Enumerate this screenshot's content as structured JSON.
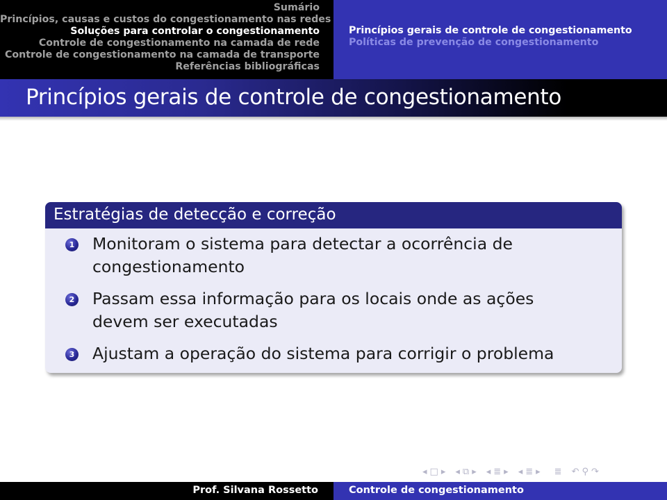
{
  "header": {
    "sections": [
      {
        "label": "Sumário",
        "current": false
      },
      {
        "label": "Princípios, causas e custos do congestionamento nas redes",
        "current": false
      },
      {
        "label": "Soluções para controlar o congestionamento",
        "current": true
      },
      {
        "label": "Controle de congestionamento na camada de rede",
        "current": false
      },
      {
        "label": "Controle de congestionamento na camada de transporte",
        "current": false
      },
      {
        "label": "Referências bibliográficas",
        "current": false
      }
    ],
    "subsections": [
      {
        "label": "Princípios gerais de controle de congestionamento",
        "current": true
      },
      {
        "label": "Políticas de prevenção de congestionamento",
        "current": false
      }
    ]
  },
  "frame": {
    "title": "Princípios gerais de controle de congestionamento"
  },
  "block": {
    "title": "Estratégias de detecção e correção",
    "items": [
      {
        "number": "1",
        "text": "Monitoram o sistema para detectar a ocorrência de congestionamento"
      },
      {
        "number": "2",
        "text": "Passam essa informação para os locais onde as ações devem ser executadas"
      },
      {
        "number": "3",
        "text": "Ajustam a operação do sistema para corrigir o problema"
      }
    ]
  },
  "navigation_symbols": {
    "frame_prev": "◂",
    "frame_icon": "□",
    "frame_next": "▸",
    "subsection_prev": "◂",
    "subsection_icon": "⧉",
    "subsection_next": "▸",
    "section_prev": "◂",
    "section_icon": "≣",
    "section_next": "▸",
    "subsub_prev": "◂",
    "subsub_icon": "≣",
    "subsub_next": "▸",
    "document_icon": "≣",
    "back_icon": "↶",
    "search_icon": "⚲",
    "forward_icon": "↷"
  },
  "footer": {
    "author": "Prof. Silvana Rossetto",
    "short_title": "Controle de congestionamento"
  },
  "colors": {
    "structure": "#3333b2",
    "block_title_bg": "#262680",
    "block_body_bg": "#ebebf7",
    "headline_left_bg": "#000000"
  }
}
